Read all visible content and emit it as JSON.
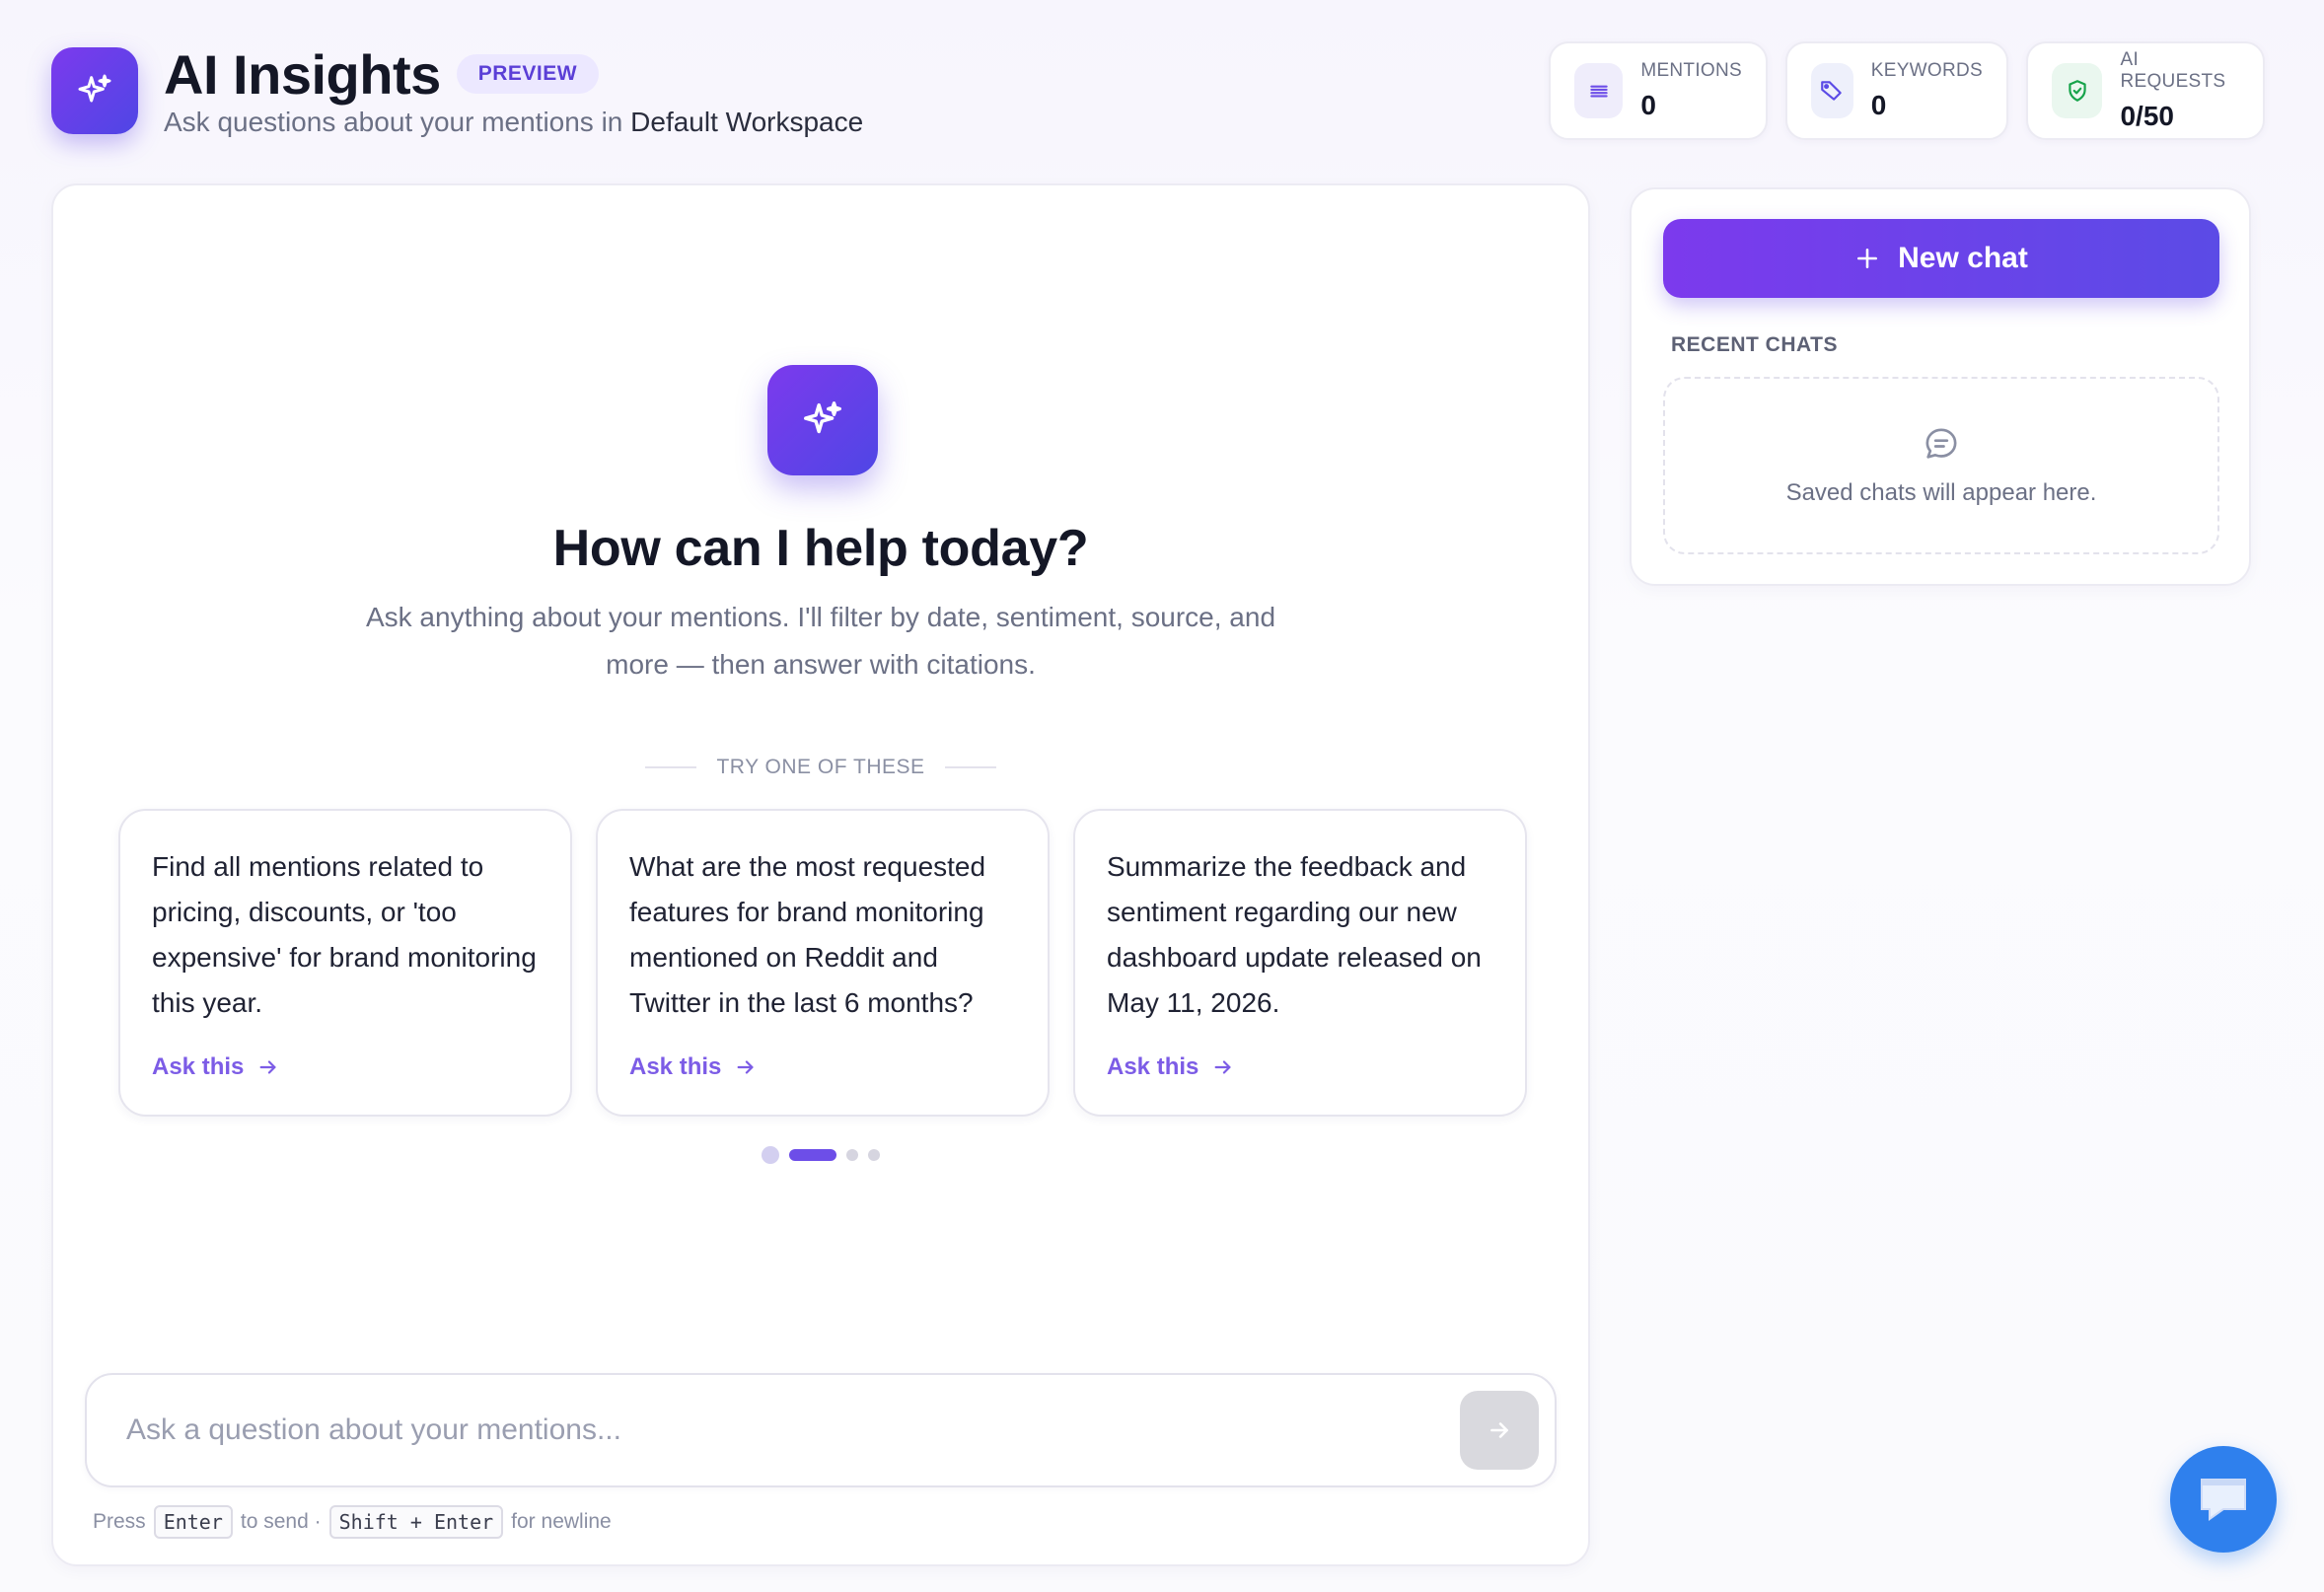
{
  "header": {
    "title": "AI Insights",
    "badge": "PREVIEW",
    "subtitle_prefix": "Ask questions about your mentions in ",
    "workspace": "Default Workspace"
  },
  "stats": [
    {
      "label": "MENTIONS",
      "value": "0",
      "icon": "list-icon",
      "color": "#6d4ee8"
    },
    {
      "label": "KEYWORDS",
      "value": "0",
      "icon": "tag-icon",
      "color": "#5b4be6"
    },
    {
      "label": "AI REQUESTS",
      "value": "0/50",
      "icon": "shield-check-icon",
      "color": "#16a34a"
    }
  ],
  "hero": {
    "heading": "How can I help today?",
    "description": "Ask anything about your mentions. I'll filter by date, sentiment, source, and more — then answer with citations."
  },
  "suggestions": {
    "label": "TRY ONE OF THESE",
    "items": [
      {
        "text": "Find all mentions related to pricing, discounts, or 'too expensive' for brand monitoring this year.",
        "action": "Ask this"
      },
      {
        "text": "What are the most requested features for brand monitoring mentioned on Reddit and Twitter in the last 6 months?",
        "action": "Ask this"
      },
      {
        "text": "Summarize the feedback and sentiment regarding our new dashboard update released on May 11, 2026.",
        "action": "Ask this"
      }
    ],
    "pages": 4,
    "active_page": 2
  },
  "composer": {
    "placeholder": "Ask a question about your mentions...",
    "hint_press": "Press",
    "hint_key_enter": "Enter",
    "hint_to_send": "to send ·",
    "hint_key_shift": "Shift + Enter",
    "hint_newline": "for newline"
  },
  "sidebar": {
    "new_chat_label": "New chat",
    "recent_label": "RECENT CHATS",
    "empty_text": "Saved chats will appear here."
  },
  "colors": {
    "accent": "#6d4ee8",
    "accent_gradient_start": "#7c3aed",
    "accent_gradient_end": "#4f46e5",
    "fab": "#2f80ed"
  }
}
